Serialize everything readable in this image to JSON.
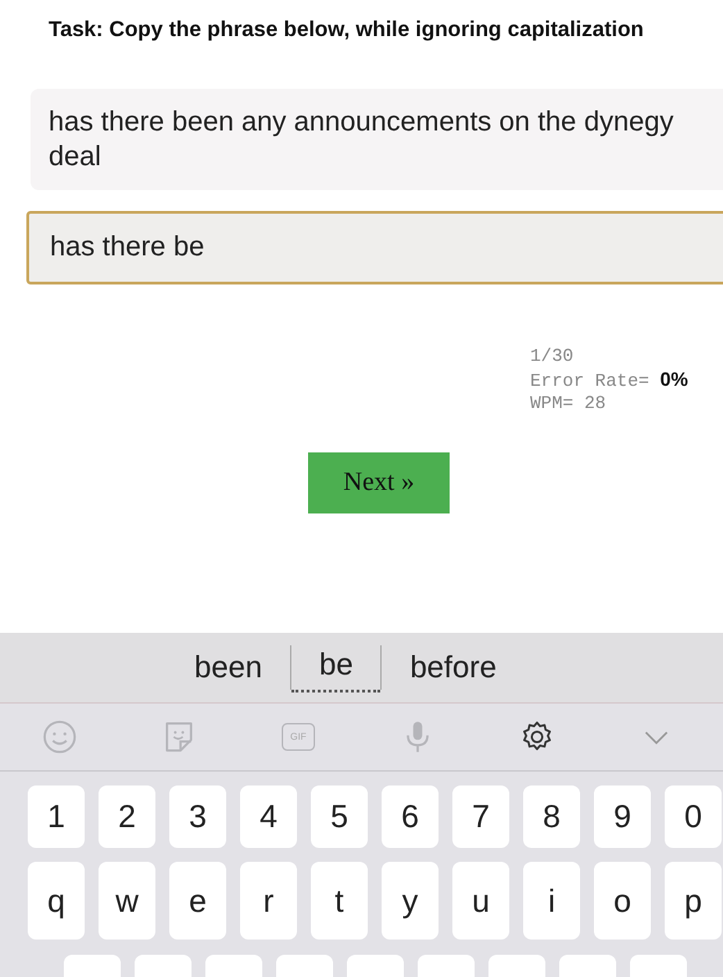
{
  "task": "Task: Copy the phrase below, while ignoring capitalization",
  "phrase": "has there been any announcements on the dynegy deal",
  "input": {
    "value": "has there be",
    "focused": true
  },
  "stats": [
    "1/30",
    "Error Rate= **0%**",
    "WPM= 28"
  ],
  "next_button": "Next »",
  "keyboard": {
    "suggestions": [
      {
        "text": "been",
        "selected": false
      },
      {
        "text": "be",
        "selected": true
      },
      {
        "text": "before",
        "selected": false
      }
    ],
    "toolbar": [
      {
        "kind": "emoji"
      },
      {
        "kind": "sticker"
      },
      {
        "kind": "gif",
        "label": "GIF"
      },
      {
        "kind": "mic"
      },
      {
        "kind": "settings"
      },
      {
        "kind": "collapse"
      }
    ],
    "rows": [
      [
        "1",
        "2",
        "3",
        "4",
        "5",
        "6",
        "7",
        "8",
        "9",
        "0"
      ],
      [
        "q",
        "w",
        "e",
        "r",
        "t",
        "y",
        "u",
        "i",
        "o",
        "p"
      ]
    ],
    "partial_row": [
      {
        "kind": "key"
      },
      {
        "kind": "key"
      },
      {
        "kind": "key"
      },
      {
        "kind": "key"
      },
      {
        "kind": "key"
      },
      {
        "kind": "key"
      },
      {
        "kind": "key"
      },
      {
        "kind": "key"
      },
      {
        "kind": "key"
      }
    ]
  }
}
